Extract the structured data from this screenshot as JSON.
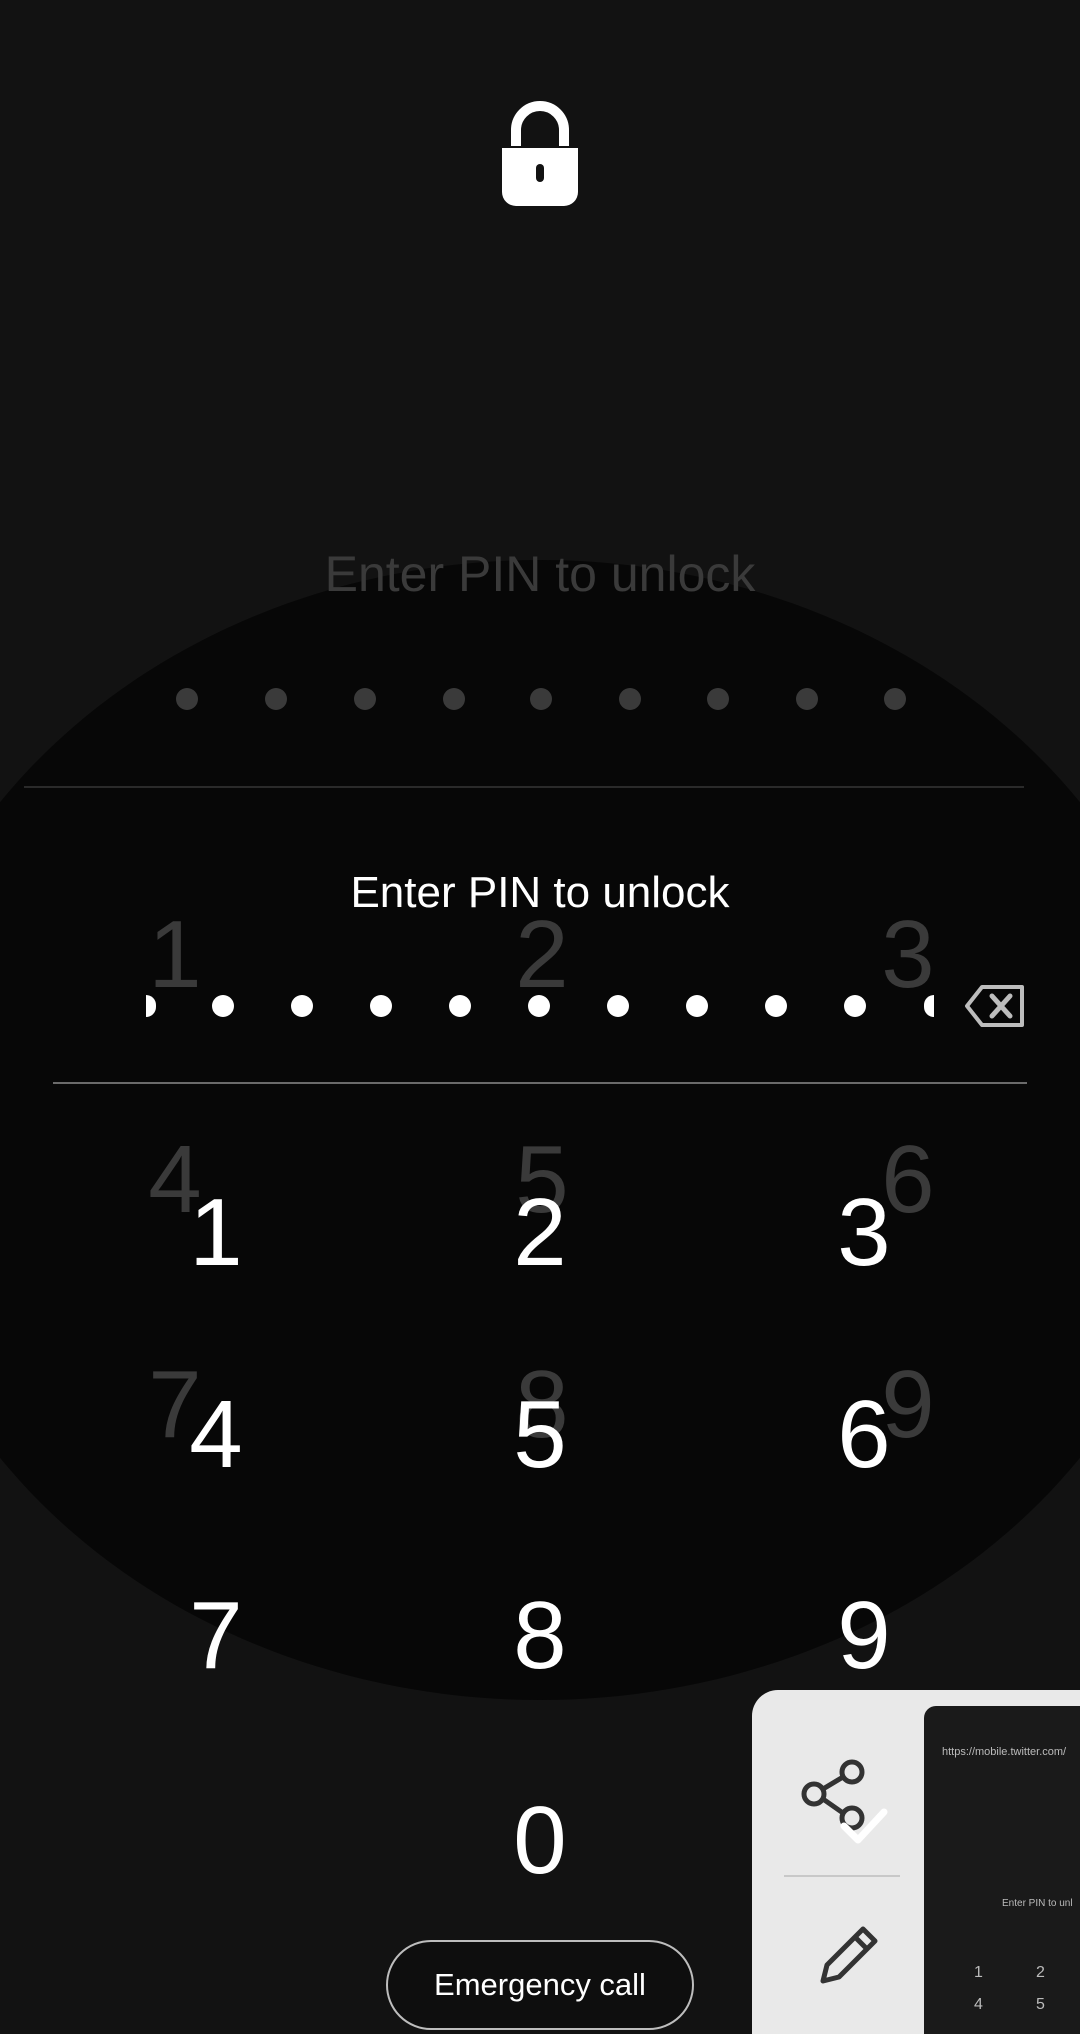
{
  "lock_screen": {
    "prompt": "Enter PIN to unlock",
    "ghost_prompt": "Enter PIN to unlock",
    "pin_dots_visible": 10,
    "keypad": {
      "keys": [
        "1",
        "2",
        "3",
        "4",
        "5",
        "6",
        "7",
        "8",
        "9",
        "0"
      ]
    },
    "ghost_keypad": {
      "keys": [
        "1",
        "2",
        "3",
        "4",
        "5",
        "6",
        "7",
        "8",
        "9"
      ]
    },
    "emergency_call_label": "Emergency call"
  },
  "screenshot_toolbar": {
    "thumbnail": {
      "url_text": "https://mobile.twitter.com/",
      "prompt": "Enter PIN to unl",
      "keys": [
        "1",
        "2",
        "4",
        "5"
      ]
    }
  },
  "icons": {
    "lock": "lock-icon",
    "backspace": "backspace-icon",
    "share": "share-icon",
    "check": "check-icon",
    "edit": "pencil-icon"
  },
  "colors": {
    "background": "#121212",
    "text": "#ffffff",
    "toolbar_bg": "#e9e9e9"
  }
}
